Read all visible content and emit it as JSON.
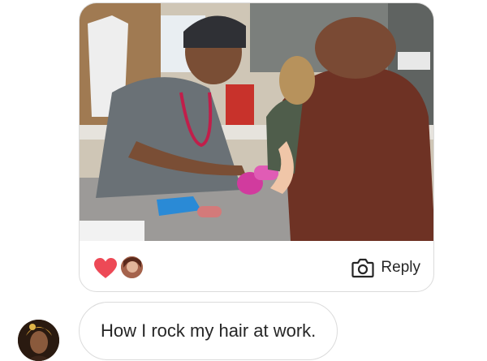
{
  "post": {
    "image_icon": "photo-vet-clinic",
    "reactions": {
      "heart_color": "#ed4956",
      "heart_icon": "heart-icon"
    },
    "reply_label": "Reply",
    "reply_icon": "camera-icon"
  },
  "message": {
    "text": "How I rock my hair at work."
  }
}
